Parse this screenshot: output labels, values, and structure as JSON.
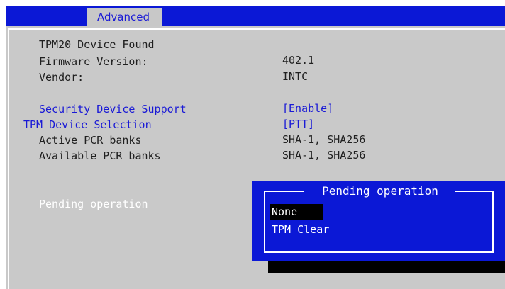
{
  "header": {
    "active_tab": "Advanced"
  },
  "info": {
    "tpm_found": "TPM20 Device Found",
    "firmware_label": "Firmware Version:",
    "firmware_value": "402.1",
    "vendor_label": "Vendor:",
    "vendor_value": "INTC"
  },
  "settings": {
    "security_support_label": "Security Device Support",
    "security_support_value": "[Enable]",
    "device_selection_label": "TPM Device Selection",
    "device_selection_value": "[PTT]",
    "active_pcr_label": "Active PCR banks",
    "active_pcr_value": "SHA-1, SHA256",
    "available_pcr_label": "Available PCR banks",
    "available_pcr_value": "SHA-1, SHA256",
    "pending_label": "Pending operation"
  },
  "popup": {
    "title": "Pending operation",
    "options": [
      "None",
      "TPM Clear"
    ],
    "selected": "None"
  },
  "colors": {
    "bios_blue": "#0b18d6",
    "panel_gray": "#c9c9c9",
    "label_blue": "#1a1ad6",
    "highlight_black": "#000000"
  }
}
